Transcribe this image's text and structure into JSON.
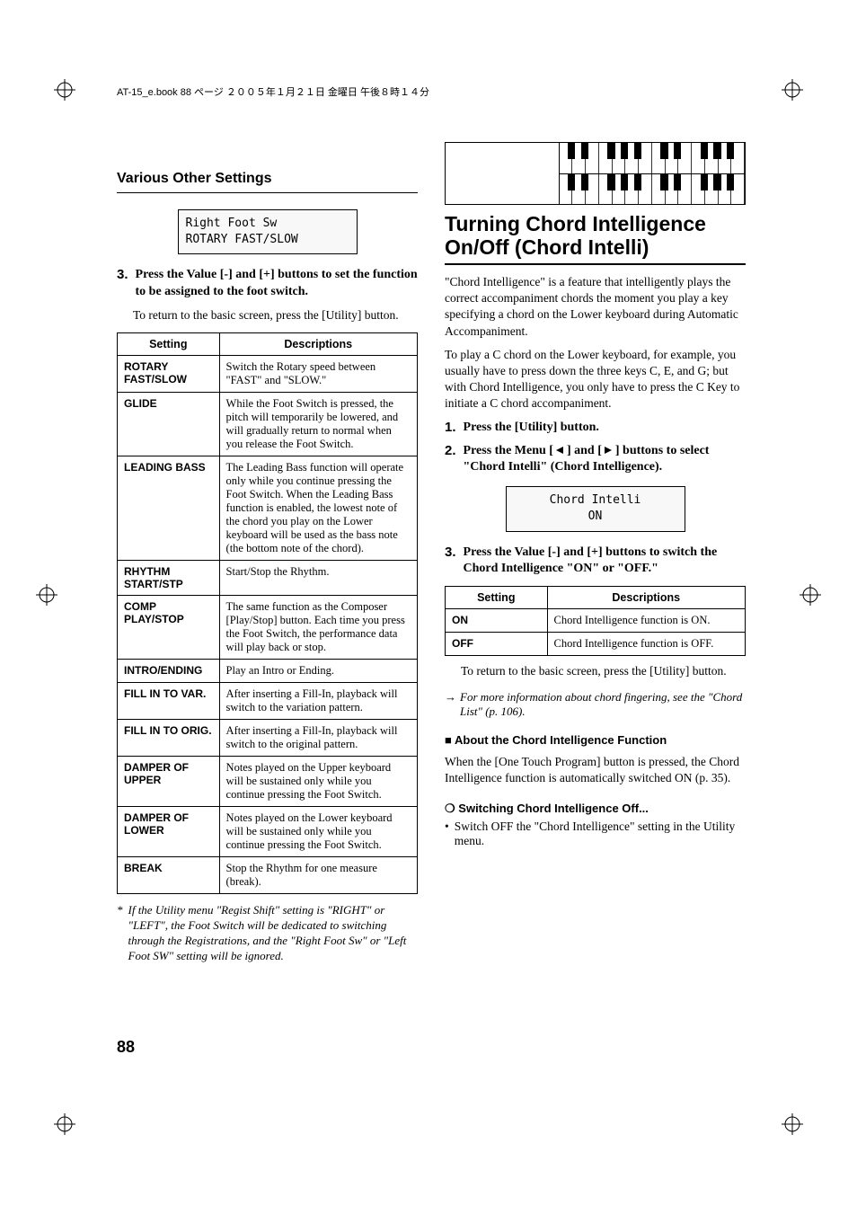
{
  "header_info": "AT-15_e.book 88 ページ ２００５年１月２１日 金曜日 午後８時１４分",
  "left": {
    "section_title": "Various Other Settings",
    "lcd_line1": "Right Foot Sw",
    "lcd_line2": "ROTARY FAST/SLOW",
    "step3_num": "3.",
    "step3_text": "Press the Value [-] and [+] buttons to set the function to be assigned to the foot switch.",
    "return_text": "To return to the basic screen, press the [Utility] button.",
    "table_header_setting": "Setting",
    "table_header_desc": "Descriptions",
    "rows": [
      {
        "s": "ROTARY FAST/SLOW",
        "d": "Switch the Rotary speed between \"FAST\" and \"SLOW.\""
      },
      {
        "s": "GLIDE",
        "d": "While the Foot Switch is pressed, the pitch will temporarily be lowered, and will gradually return to normal when you release the Foot Switch."
      },
      {
        "s": "LEADING BASS",
        "d": "The Leading Bass function will operate only while you continue pressing the Foot Switch. When the Leading Bass function is enabled, the lowest note of the chord you play on the Lower keyboard will be used as the bass note (the bottom note of the chord)."
      },
      {
        "s": "RHYTHM START/STP",
        "d": "Start/Stop the Rhythm."
      },
      {
        "s": "COMP PLAY/STOP",
        "d": "The same function as the Composer [Play/Stop] button. Each time you press the Foot Switch, the performance data will play back or stop."
      },
      {
        "s": "INTRO/ENDING",
        "d": "Play an Intro or Ending."
      },
      {
        "s": "FILL IN TO VAR.",
        "d": "After inserting a Fill-In, playback will switch to the variation pattern."
      },
      {
        "s": "FILL IN TO ORIG.",
        "d": "After inserting a Fill-In, playback will switch to the original pattern."
      },
      {
        "s": "DAMPER OF UPPER",
        "d": "Notes played on the Upper keyboard will be sustained only while you continue pressing the Foot Switch."
      },
      {
        "s": "DAMPER OF LOWER",
        "d": "Notes played on the Lower keyboard will be sustained only while you continue pressing the Foot Switch."
      },
      {
        "s": "BREAK",
        "d": "Stop the Rhythm for one measure (break)."
      }
    ],
    "footnote_star": "*",
    "footnote": "If the Utility menu \"Regist Shift\" setting is \"RIGHT\" or \"LEFT\", the Foot Switch will be dedicated to switching through the Registrations, and the \"Right Foot Sw\" or \"Left Foot SW\" setting will be ignored."
  },
  "right": {
    "title": "Turning Chord Intelligence On/Off (Chord Intelli)",
    "para1": "\"Chord Intelligence\" is a feature that intelligently plays the correct accompaniment chords the moment you play a key specifying a chord on the Lower keyboard during Automatic Accompaniment.",
    "para2": "To play a C chord on the Lower keyboard, for example, you usually have to press down the three keys C, E, and G; but with Chord Intelligence, you only have to press the C Key to initiate a C chord accompaniment.",
    "step1_num": "1.",
    "step1_text": "Press the [Utility] button.",
    "step2_num": "2.",
    "step2_text_a": "Press the Menu [",
    "step2_text_b": "] and [",
    "step2_text_c": "] buttons to select \"Chord Intelli\" (Chord Intelligence).",
    "lcd_line1": "Chord Intelli",
    "lcd_line2": "ON",
    "step3_num": "3.",
    "step3_text": "Press the Value [-] and [+] buttons to switch the Chord Intelligence \"ON\" or \"OFF.\"",
    "table_header_setting": "Setting",
    "table_header_desc": "Descriptions",
    "rows": [
      {
        "s": "ON",
        "d": "Chord Intelligence function is ON."
      },
      {
        "s": "OFF",
        "d": "Chord Intelligence function is OFF."
      }
    ],
    "return_text": "To return to the basic screen, press the [Utility] button.",
    "ref_arrow": "→",
    "ref_text": "For more information about chord fingering, see the \"Chord List\" (p. 106).",
    "sub1_box": "■",
    "sub1": "About the Chord Intelligence Function",
    "sub1_para": "When the [One Touch Program] button is pressed, the Chord Intelligence function is automatically switched ON (p. 35).",
    "sub2_circ": "❍",
    "sub2": "Switching Chord Intelligence Off...",
    "sub2_bullet": "Switch OFF the \"Chord Intelligence\" setting in the Utility menu."
  },
  "page_number": "88"
}
